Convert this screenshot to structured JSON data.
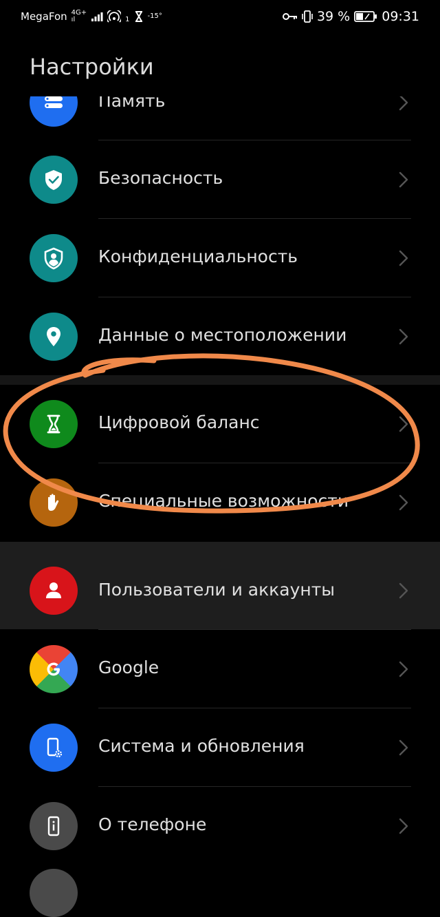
{
  "status_bar": {
    "carrier": "MegaFon",
    "network_top": "4G+",
    "network_bottom": "ıl",
    "hotspot_count": "1",
    "temperature": "-15°",
    "battery_percent": "39 %",
    "time": "09:31"
  },
  "page_title": "Настройки",
  "items": [
    {
      "label": "Память",
      "icon": "storage-icon",
      "color": "#1f6ef0"
    },
    {
      "label": "Безопасность",
      "icon": "shield-check-icon",
      "color": "#0e8a8a"
    },
    {
      "label": "Конфиденциальность",
      "icon": "privacy-icon",
      "color": "#0e8a8a"
    },
    {
      "label": "Данные о местоположении",
      "icon": "location-pin-icon",
      "color": "#0e8a8a"
    },
    {
      "label": "Цифровой баланс",
      "icon": "hourglass-icon",
      "color": "#0f8a1c"
    },
    {
      "label": "Специальные возможности",
      "icon": "hand-icon",
      "color": "#b5650e"
    },
    {
      "label": "Пользователи и аккаунты",
      "icon": "user-icon",
      "color": "#d8141a"
    },
    {
      "label": "Google",
      "icon": "google-icon",
      "color": "#ffffff"
    },
    {
      "label": "Система и обновления",
      "icon": "phone-settings-icon",
      "color": "#1f6ef0"
    },
    {
      "label": "О телефоне",
      "icon": "phone-info-icon",
      "color": "#4a4a4a"
    }
  ],
  "annotation_color": "#f0894a"
}
